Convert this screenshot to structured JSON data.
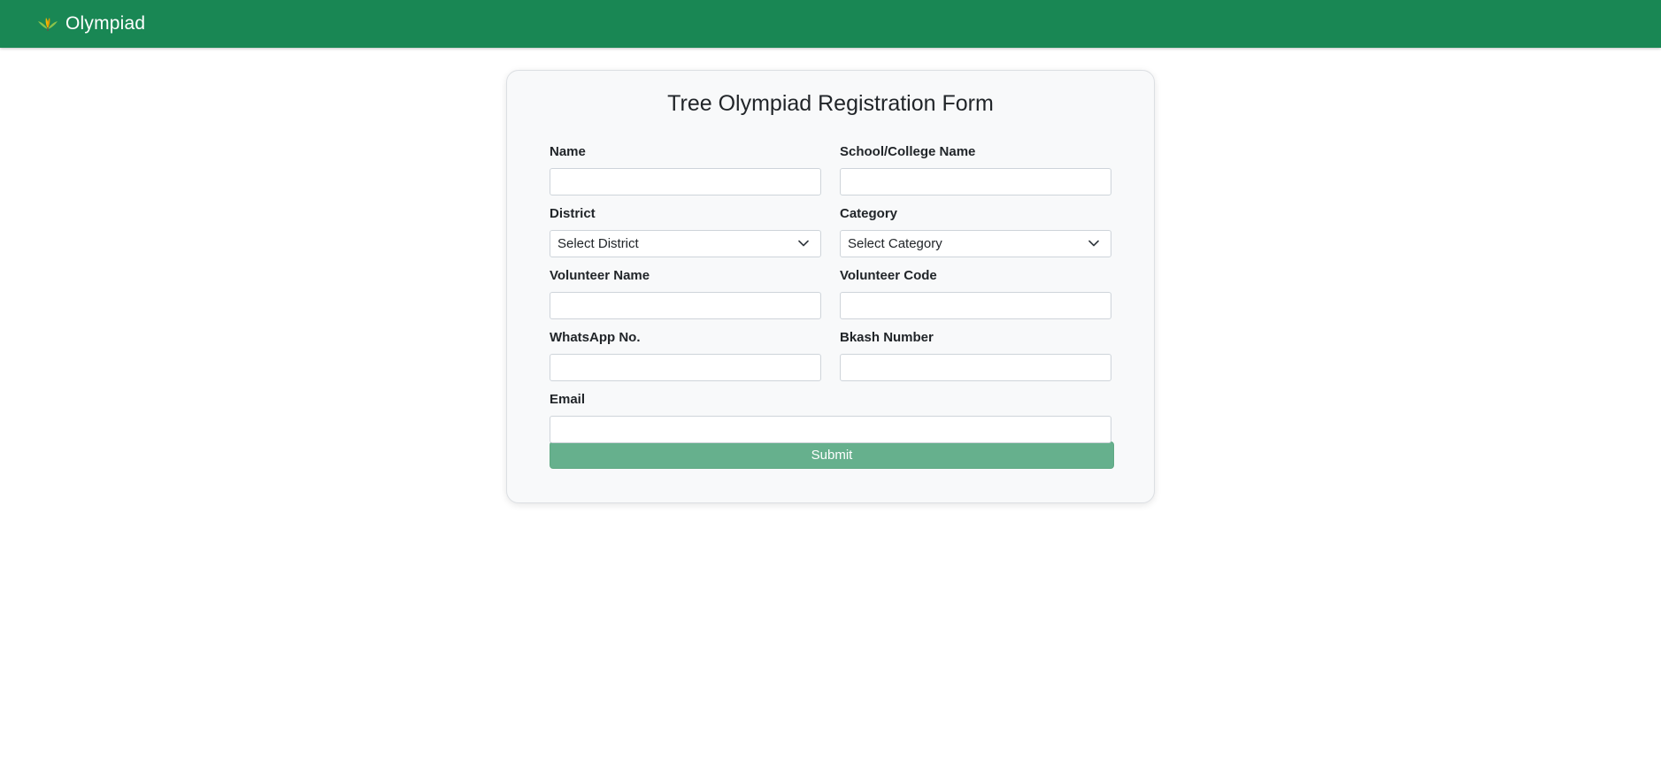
{
  "navbar": {
    "brand_text": "Olympiad",
    "brand_icon": "leaf-logo-icon",
    "background_color": "#198754"
  },
  "form": {
    "title": "Tree Olympiad Registration Form",
    "fields": {
      "name": {
        "label": "Name",
        "value": ""
      },
      "school": {
        "label": "School/College Name",
        "value": ""
      },
      "district": {
        "label": "District",
        "selected": "Select District"
      },
      "category": {
        "label": "Category",
        "selected": "Select Category"
      },
      "volunteer_name": {
        "label": "Volunteer Name",
        "value": ""
      },
      "volunteer_code": {
        "label": "Volunteer Code",
        "value": ""
      },
      "whatsapp": {
        "label": "WhatsApp No.",
        "value": ""
      },
      "bkash": {
        "label": "Bkash Number",
        "value": ""
      },
      "email": {
        "label": "Email",
        "value": ""
      }
    },
    "submit_label": "Submit",
    "submit_color": "#66b08d"
  }
}
